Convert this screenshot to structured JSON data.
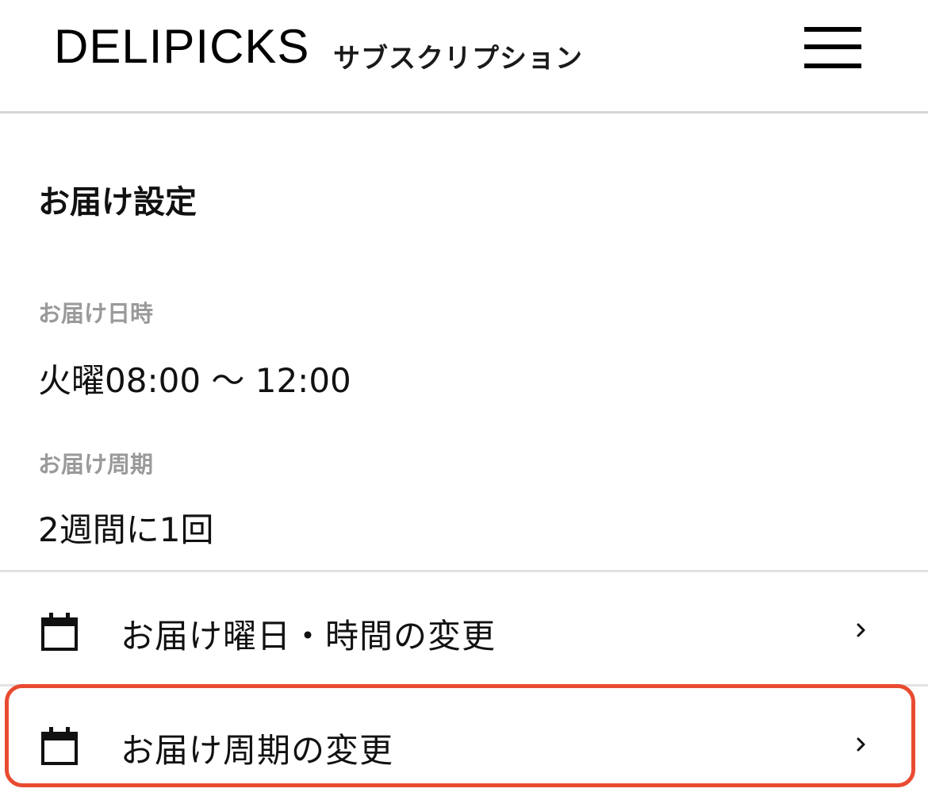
{
  "header": {
    "brand": "DELIPICKS",
    "brand_sub": "サブスクリプション",
    "menu_icon": "hamburger-menu-icon"
  },
  "section": {
    "title": "お届け設定"
  },
  "fields": [
    {
      "label": "お届け日時",
      "value": "火曜08:00 〜 12:00"
    },
    {
      "label": "お届け周期",
      "value": "2週間に1回"
    }
  ],
  "actions": [
    {
      "label": "お届け曜日・時間の変更",
      "icon": "calendar-icon"
    },
    {
      "label": "お届け周期の変更",
      "icon": "calendar-icon"
    }
  ],
  "colors": {
    "highlight": "#e84b30",
    "label_gray": "#9a9a9a",
    "divider": "#e2e2e2"
  }
}
